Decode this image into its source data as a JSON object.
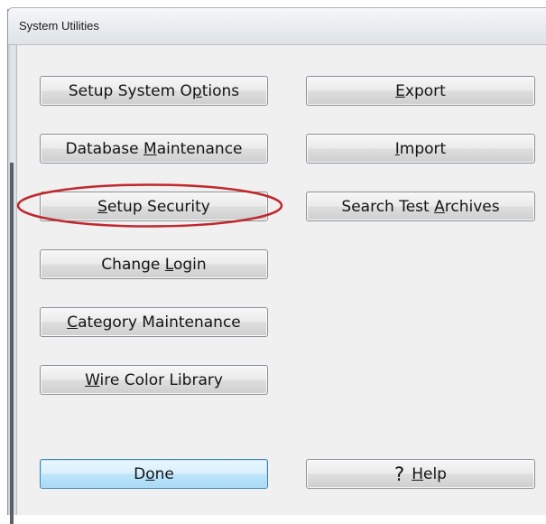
{
  "window": {
    "title": "System Utilities"
  },
  "buttons": {
    "setup_system_options": {
      "pre": "Setup System O",
      "mn": "p",
      "post": "tions"
    },
    "export": {
      "pre": "",
      "mn": "E",
      "post": "xport"
    },
    "database_maintenance": {
      "pre": "Database ",
      "mn": "M",
      "post": "aintenance"
    },
    "import": {
      "pre": "",
      "mn": "I",
      "post": "mport"
    },
    "setup_security": {
      "pre": "",
      "mn": "S",
      "post": "etup Security"
    },
    "search_test_archives": {
      "pre": "Search Test ",
      "mn": "A",
      "post": "rchives"
    },
    "change_login": {
      "pre": "Change ",
      "mn": "L",
      "post": "ogin"
    },
    "category_maintenance": {
      "pre": "",
      "mn": "C",
      "post": "ategory Maintenance"
    },
    "wire_color_library": {
      "pre": "",
      "mn": "W",
      "post": "ire Color Library"
    },
    "done": {
      "pre": "D",
      "mn": "o",
      "post": "ne"
    },
    "help": {
      "symbol": "?",
      "pre": "",
      "mn": "H",
      "post": "elp"
    }
  },
  "colors": {
    "highlight_oval": "#c0282d",
    "default_button_border": "#3c7fb1"
  }
}
